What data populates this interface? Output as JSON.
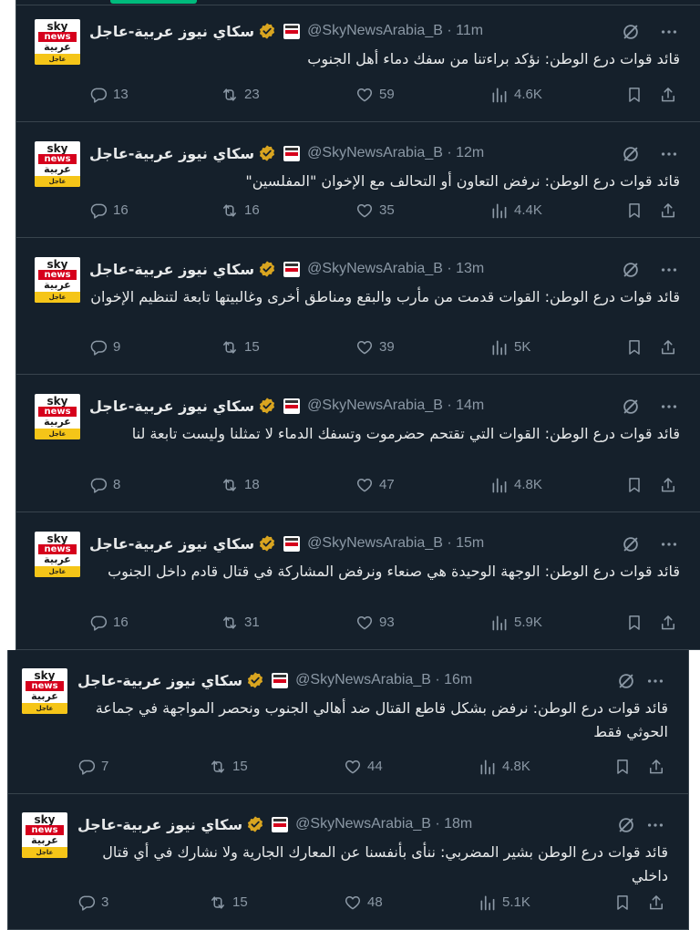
{
  "account": {
    "name": "سكاي نيوز عربية-عاجل",
    "handle": "@SkyNewsArabia_B",
    "avatar_sky": "sky",
    "avatar_news": "news",
    "avatar_arabic": "عربية",
    "avatar_bar": "عاجل"
  },
  "colors": {
    "background": "#15202b",
    "divider": "#38444d",
    "text": "#e7e9ea",
    "muted": "#8b98a5",
    "verified": "#d9a520",
    "tab_indicator": "#00ba7c"
  },
  "tweets": [
    {
      "time": "11m",
      "text": "قائد قوات درع الوطن: نؤكد براءتنا من سفك دماء أهل الجنوب",
      "replies": "13",
      "reposts": "23",
      "likes": "59",
      "views": "4.6K"
    },
    {
      "time": "12m",
      "text": "قائد قوات درع الوطن: نرفض التعاون أو التحالف مع الإخوان \"المفلسين\"",
      "replies": "16",
      "reposts": "16",
      "likes": "35",
      "views": "4.4K"
    },
    {
      "time": "13m",
      "text": "قائد قوات درع الوطن: القوات قدمت من مأرب والبقع ومناطق أخرى وغالبيتها تابعة لتنظيم الإخوان",
      "replies": "9",
      "reposts": "15",
      "likes": "39",
      "views": "5K"
    },
    {
      "time": "14m",
      "text": "قائد قوات درع الوطن: القوات التي تقتحم حضرموت وتسفك الدماء لا تمثلنا وليست تابعة لنا",
      "replies": "8",
      "reposts": "18",
      "likes": "47",
      "views": "4.8K"
    },
    {
      "time": "15m",
      "text": "قائد قوات درع الوطن: الوجهة الوحيدة هي صنعاء ونرفض المشاركة في قتال قادم داخل الجنوب",
      "replies": "16",
      "reposts": "31",
      "likes": "93",
      "views": "5.9K"
    },
    {
      "time": "16m",
      "text": "قائد قوات درع الوطن: نرفض بشكل قاطع القتال ضد أهالي الجنوب ونحصر المواجهة في جماعة الحوثي فقط",
      "replies": "7",
      "reposts": "15",
      "likes": "44",
      "views": "4.8K"
    },
    {
      "time": "18m",
      "text": "قائد قوات درع الوطن بشير المضربي: ننأى بأنفسنا عن المعارك الجارية ولا نشارك في أي قتال داخلي",
      "replies": "3",
      "reposts": "15",
      "likes": "48",
      "views": "5.1K"
    }
  ]
}
